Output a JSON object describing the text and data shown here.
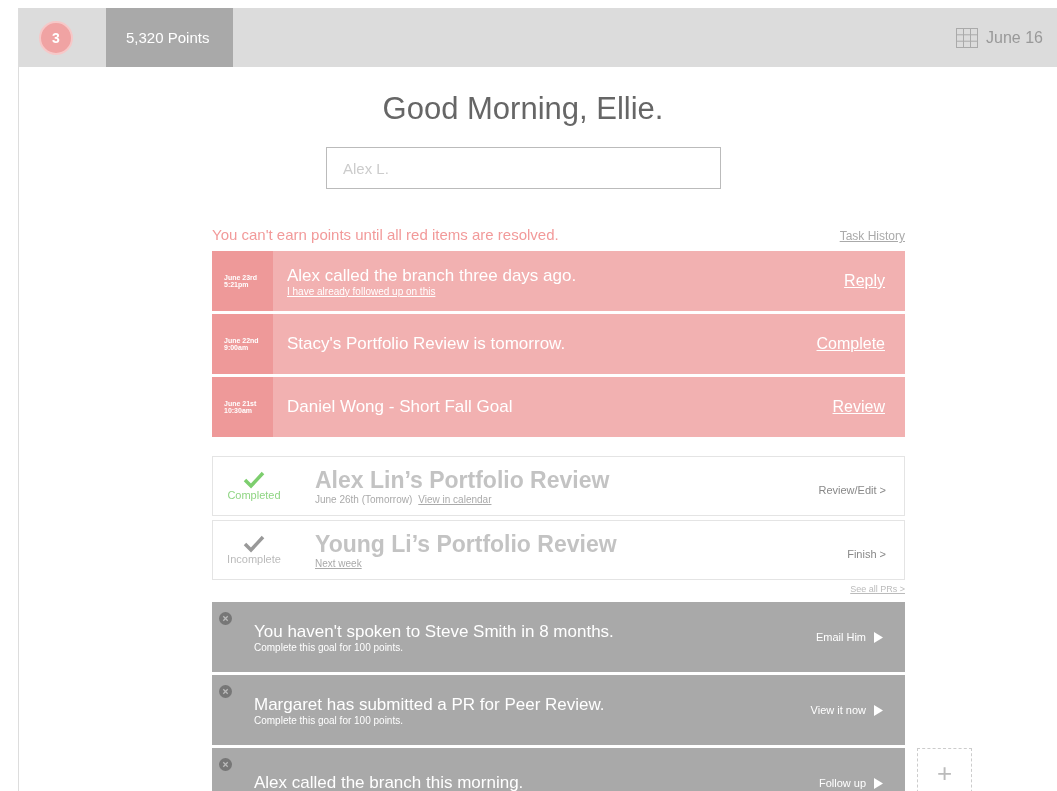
{
  "topbar": {
    "badge": "3",
    "points": "5,320 Points",
    "date": "June 16"
  },
  "greeting": "Good Morning, Ellie.",
  "search": {
    "placeholder": "Alex L."
  },
  "warning": "You can't earn points until all red items are resolved.",
  "task_history": "Task History",
  "alerts": [
    {
      "date": "June 23rd",
      "time": "5:21pm",
      "title": "Alex called the branch three days ago.",
      "sub_link": "I have already followed up on this",
      "action": "Reply"
    },
    {
      "date": "June 22nd",
      "time": "9:00am",
      "title": "Stacy's Portfolio Review is tomorrow.",
      "action": "Complete"
    },
    {
      "date": "June 21st",
      "time": "10:30am",
      "title": "Daniel Wong - Short Fall Goal",
      "action": "Review"
    }
  ],
  "reviews": [
    {
      "completed": true,
      "status": "Completed",
      "title": "Alex Lin’s Portfolio Review",
      "note": "June 26th (Tomorrow)",
      "link": "View in calendar",
      "action": "Review/Edit >"
    },
    {
      "completed": false,
      "status": "Incomplete",
      "title": "Young Li’s Portfolio Review",
      "link": "Next week",
      "action": "Finish >"
    }
  ],
  "see_all": "See all PRs >",
  "goals": [
    {
      "title": "You haven't spoken to Steve Smith in 8 months.",
      "sub": "Complete this goal for 100 points.",
      "action": "Email Him"
    },
    {
      "title": "Margaret has submitted a PR for Peer Review.",
      "sub": "Complete this goal for 100 points.",
      "action": "View it now"
    },
    {
      "title": "Alex called the branch this morning.",
      "action": "Follow up"
    }
  ],
  "add_button": "+"
}
